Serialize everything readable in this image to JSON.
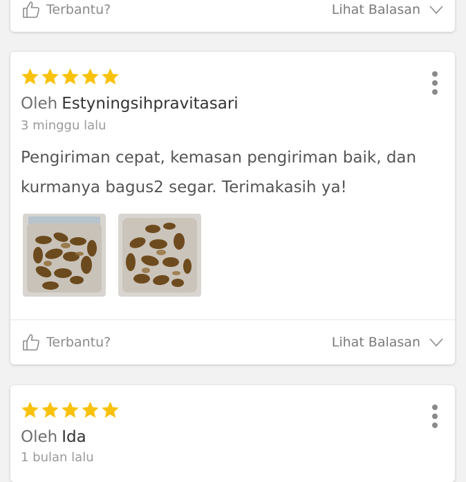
{
  "reviews": [
    {
      "helpful_label": "Terbantu?",
      "replies_label": "Lihat Balasan"
    },
    {
      "rating": 5,
      "author_prefix": "Oleh",
      "author_name": "Estyningsihpravitasari",
      "time_ago": "3 minggu lalu",
      "text": "Pengiriman cepat, kemasan pengiriman baik, dan kurmanya bagus2 segar. Terimakasih ya!",
      "photos": [
        "dates-photo-1",
        "dates-photo-2"
      ],
      "helpful_label": "Terbantu?",
      "replies_label": "Lihat Balasan"
    },
    {
      "rating": 5,
      "author_prefix": "Oleh",
      "author_name": "Ida",
      "time_ago": "1 bulan lalu"
    }
  ],
  "colors": {
    "star": "#F9C20A",
    "muted_text": "#8a8a8a",
    "body_text": "#555555",
    "background": "#f2f2f2"
  }
}
